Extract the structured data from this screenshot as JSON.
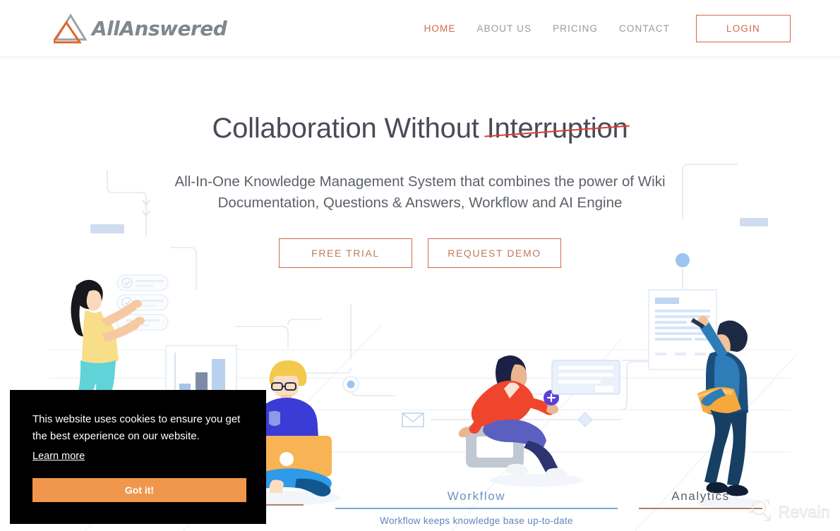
{
  "header": {
    "logo": {
      "icon": "triangle-logo-icon",
      "text_first": "All",
      "text_second": "Answered",
      "color_gray": "#808a8f",
      "color_orange": "#e0662a"
    },
    "nav": [
      {
        "label": "HOME",
        "active": true
      },
      {
        "label": "ABOUT US",
        "active": false
      },
      {
        "label": "PRICING",
        "active": false
      },
      {
        "label": "CONTACT",
        "active": false
      }
    ],
    "login_label": "LOGIN",
    "accent_color": "#cf6b43"
  },
  "hero": {
    "title_plain": "Collaboration Without ",
    "title_struck": "Interruption",
    "strike_color": "#e03c31",
    "subtitle_line1": "All-In-One Knowledge Management System that combines the power of Wiki",
    "subtitle_line2": "Documentation, Questions & Answers, Workflow and AI Engine",
    "buttons": [
      {
        "label": "FREE TRIAL"
      },
      {
        "label": "REQUEST DEMO"
      }
    ]
  },
  "features": [
    {
      "label": "",
      "description": "",
      "active": false,
      "rule": "tan"
    },
    {
      "label": "Workflow",
      "description": "Workflow keeps knowledge base up-to-date",
      "active": true,
      "rule": "blue"
    },
    {
      "label": "Analytics",
      "description": "",
      "active": false,
      "rule": "tan"
    }
  ],
  "cookie_banner": {
    "message": "This website uses cookies to ensure you get the best experience on our website.",
    "learn_more_label": "Learn more",
    "accept_label": "Got it!",
    "background": "#000000",
    "button_color": "#f0974d"
  },
  "watermark": {
    "label": "Revain",
    "icon": "revain-magnifier-icon"
  },
  "illustration": {
    "figures": [
      "woman-yellow-top-checklist",
      "man-blonde-laptop-seated",
      "woman-red-jacket-plus-button",
      "man-blue-suit-writing-document"
    ],
    "objects": [
      "bar-chart-panel",
      "checklist-cards",
      "envelope-icon",
      "document-panel",
      "plus-badge-icon",
      "node-circle"
    ]
  }
}
